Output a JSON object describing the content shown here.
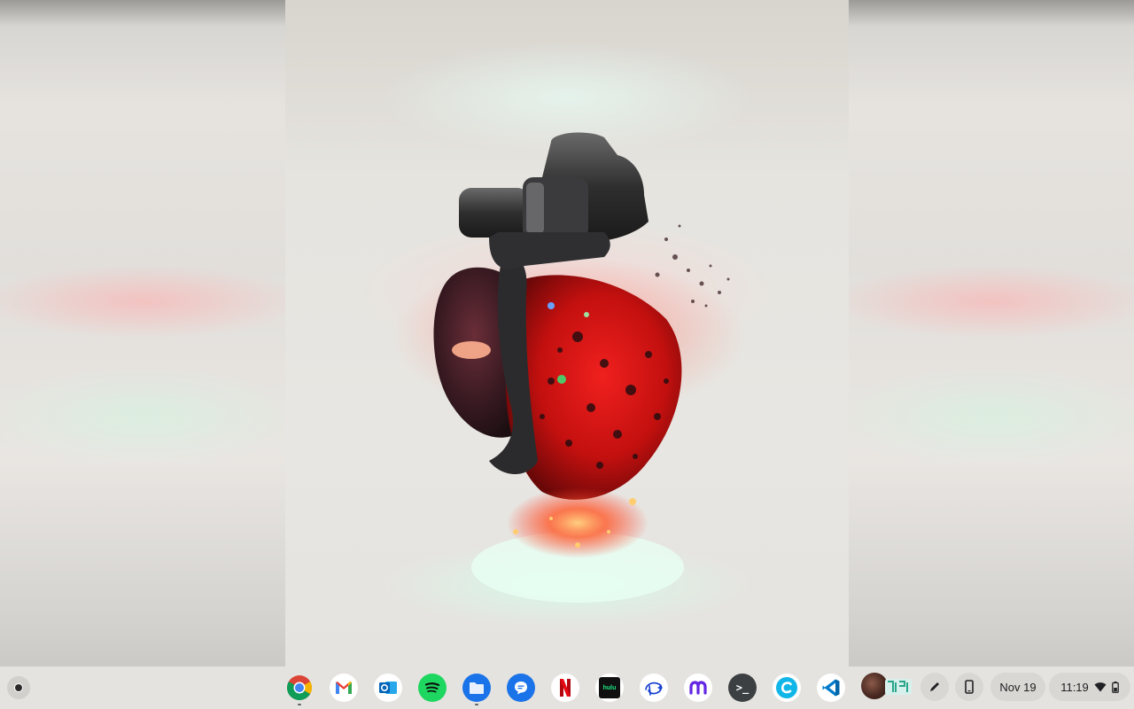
{
  "shelf": {
    "apps": [
      {
        "name": "Chrome",
        "icon": "chrome-icon",
        "running": true
      },
      {
        "name": "Gmail",
        "icon": "gmail-icon",
        "running": false
      },
      {
        "name": "Outlook",
        "icon": "outlook-icon",
        "running": false
      },
      {
        "name": "Spotify",
        "icon": "spotify-icon",
        "running": false
      },
      {
        "name": "Files",
        "icon": "files-icon",
        "running": true
      },
      {
        "name": "Messages",
        "icon": "messages-icon",
        "running": false
      },
      {
        "name": "Netflix",
        "icon": "netflix-icon",
        "running": false
      },
      {
        "name": "Hulu",
        "icon": "hulu-icon",
        "label": "hulu",
        "running": false
      },
      {
        "name": "Disney+",
        "icon": "disney-plus-icon",
        "running": false
      },
      {
        "name": "Max",
        "icon": "max-icon",
        "running": false
      },
      {
        "name": "Terminal",
        "icon": "terminal-icon",
        "label": ">_",
        "running": false
      },
      {
        "name": "Canva",
        "icon": "canva-icon",
        "running": false
      },
      {
        "name": "Visual Studio Code",
        "icon": "vscode-icon",
        "running": false
      }
    ]
  },
  "tray": {
    "date": "Nov 19",
    "time": "11:19",
    "icons": [
      "stylus-icon",
      "phone-hub-icon",
      "wifi-icon",
      "battery-icon"
    ]
  },
  "colors": {
    "shelf_bg": "#e5e3df",
    "pill_bg": "#d9d7d3"
  }
}
